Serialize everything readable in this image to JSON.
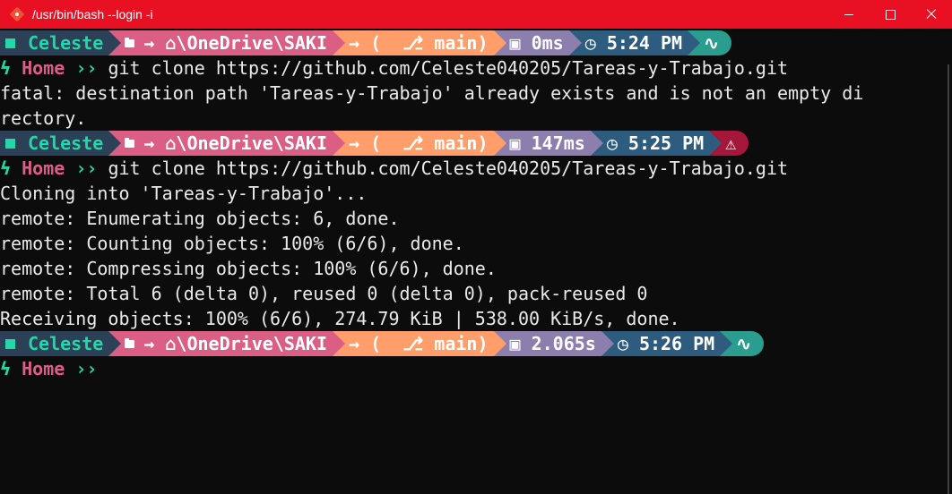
{
  "window": {
    "title": "/usr/bin/bash --login -i",
    "accent": "#e81123"
  },
  "prompts": [
    {
      "user": "Celeste",
      "path": "→ ⌂\\OneDrive\\SAKI",
      "git": "→ (  ⎇ main)",
      "exec_time": "0ms",
      "time": "5:24 PM",
      "status_icon": "⚡",
      "status_name": "pulse-icon",
      "status_color": "#2a9d8f",
      "command": "git clone https://github.com/Celeste040205/Tareas-y-Trabajo.git"
    },
    {
      "user": "Celeste",
      "path": "→ ⌂\\OneDrive\\SAKI",
      "git": "→ (  ⎇ main)",
      "exec_time": "147ms",
      "time": "5:25 PM",
      "status_icon": "⚠",
      "status_name": "warning-icon",
      "status_color": "#a4173a",
      "command": "git clone https://github.com/Celeste040205/Tareas-y-Trabajo.git"
    },
    {
      "user": "Celeste",
      "path": "→ ⌂\\OneDrive\\SAKI",
      "git": "→ (  ⎇ main)",
      "exec_time": "2.065s",
      "time": "5:26 PM",
      "status_icon": "⚡",
      "status_name": "pulse-icon",
      "status_color": "#2a9d8f",
      "command": ""
    }
  ],
  "home_label": "Home",
  "prompt_symbol": "››",
  "output1": [
    "fatal: destination path 'Tareas-y-Trabajo' already exists and is not an empty di",
    "rectory."
  ],
  "output2": [
    "Cloning into 'Tareas-y-Trabajo'...",
    "remote: Enumerating objects: 6, done.",
    "remote: Counting objects: 100% (6/6), done.",
    "remote: Compressing objects: 100% (6/6), done.",
    "remote: Total 6 (delta 0), reused 0 (delta 0), pack-reused 0",
    "Receiving objects: 100% (6/6), 274.79 KiB | 538.00 KiB/s, done."
  ]
}
